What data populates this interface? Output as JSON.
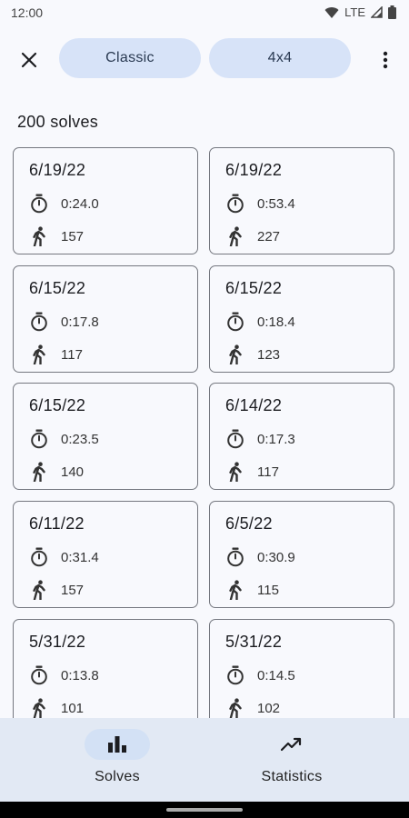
{
  "status_bar": {
    "time": "12:00",
    "network": "LTE"
  },
  "top_bar": {
    "chips": [
      "Classic",
      "4x4"
    ]
  },
  "solves_count": "200 solves",
  "solves": [
    {
      "date": "6/19/22",
      "time": "0:24.0",
      "moves": "157"
    },
    {
      "date": "6/19/22",
      "time": "0:53.4",
      "moves": "227"
    },
    {
      "date": "6/15/22",
      "time": "0:17.8",
      "moves": "117"
    },
    {
      "date": "6/15/22",
      "time": "0:18.4",
      "moves": "123"
    },
    {
      "date": "6/15/22",
      "time": "0:23.5",
      "moves": "140"
    },
    {
      "date": "6/14/22",
      "time": "0:17.3",
      "moves": "117"
    },
    {
      "date": "6/11/22",
      "time": "0:31.4",
      "moves": "157"
    },
    {
      "date": "6/5/22",
      "time": "0:30.9",
      "moves": "115"
    },
    {
      "date": "5/31/22",
      "time": "0:13.8",
      "moves": "101"
    },
    {
      "date": "5/31/22",
      "time": "0:14.5",
      "moves": "102"
    }
  ],
  "bottom_nav": {
    "items": [
      "Solves",
      "Statistics"
    ],
    "selected": "Solves"
  },
  "colors": {
    "chip_bg": "#d7e3f8",
    "nav_bg": "#e2e9f4",
    "card_border": "#74777f"
  }
}
